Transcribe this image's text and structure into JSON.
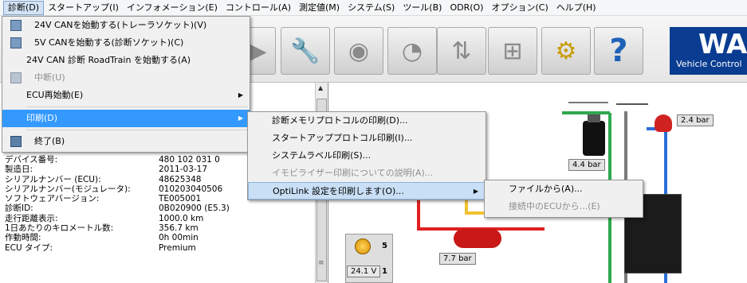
{
  "menubar": [
    "診断(D)",
    "スタートアップ(I)",
    "インフォメーション(E)",
    "コントロール(A)",
    "測定値(M)",
    "システム(S)",
    "ツール(B)",
    "ODR(O)",
    "オプション(C)",
    "ヘルプ(H)"
  ],
  "brand": {
    "logo": "WAB",
    "tagline": "Vehicle Control"
  },
  "diagnosis_menu": {
    "start_24v": "24V CANを始動する(トレーラソケット)(V)",
    "start_5v": "5V CANを始動する(診断ソケット)(C)",
    "start_roadtrain": "24V CAN 診断 RoadTrain を始動する(A)",
    "interrupt": "中断(U)",
    "ecu_restart": "ECU再始動(E)",
    "print": "印刷(D)",
    "exit": "終了(B)"
  },
  "print_menu": {
    "diag_memory": "診断メモリプロトコルの印刷(D)...",
    "startup_protocol": "スタートアッププロトコル印刷(I)...",
    "system_label": "システムラベル印刷(S)...",
    "immobilizer": "イモビライザー印刷についての説明(A)...",
    "optilink": "OptiLink 設定を印刷します(O)..."
  },
  "optilink_menu": {
    "from_file": "ファイルから(A)...",
    "from_ecu": "接続中のECUから...(E)"
  },
  "device_info": [
    {
      "label": "デバイス番号:",
      "value": "480 102 031 0"
    },
    {
      "label": "製造日:",
      "value": "2011-03-17"
    },
    {
      "label": "シリアルナンバー (ECU):",
      "value": "48625348"
    },
    {
      "label": "シリアルナンバー(モジュレータ):",
      "value": "010203040506"
    },
    {
      "label": "ソフトウェアバージョン:",
      "value": "TE005001"
    },
    {
      "label": "診断ID:",
      "value": "0B020900 (E5.3)"
    },
    {
      "label": "走行距離表示:",
      "value": "1000.0 km"
    },
    {
      "label": "1日あたりのキロメートル数:",
      "value": "356.7 km"
    },
    {
      "label": "作動時間:",
      "value": "0h 00min"
    },
    {
      "label": "ECU タイプ:",
      "value": "Premium"
    }
  ],
  "diagram": {
    "pressure_1": "2.4 bar",
    "pressure_2": "4.4 bar",
    "pressure_3": "7.7 bar",
    "voltage": "24.1 V",
    "slot_5": "5",
    "slot_1": "1"
  },
  "colors": {
    "highlight": "#3399ff",
    "brand": "#0a3d91",
    "pipe_red": "#e02020",
    "pipe_green": "#2fa84f",
    "pipe_blue": "#2b6fd6",
    "pipe_yellow": "#f2c230"
  }
}
